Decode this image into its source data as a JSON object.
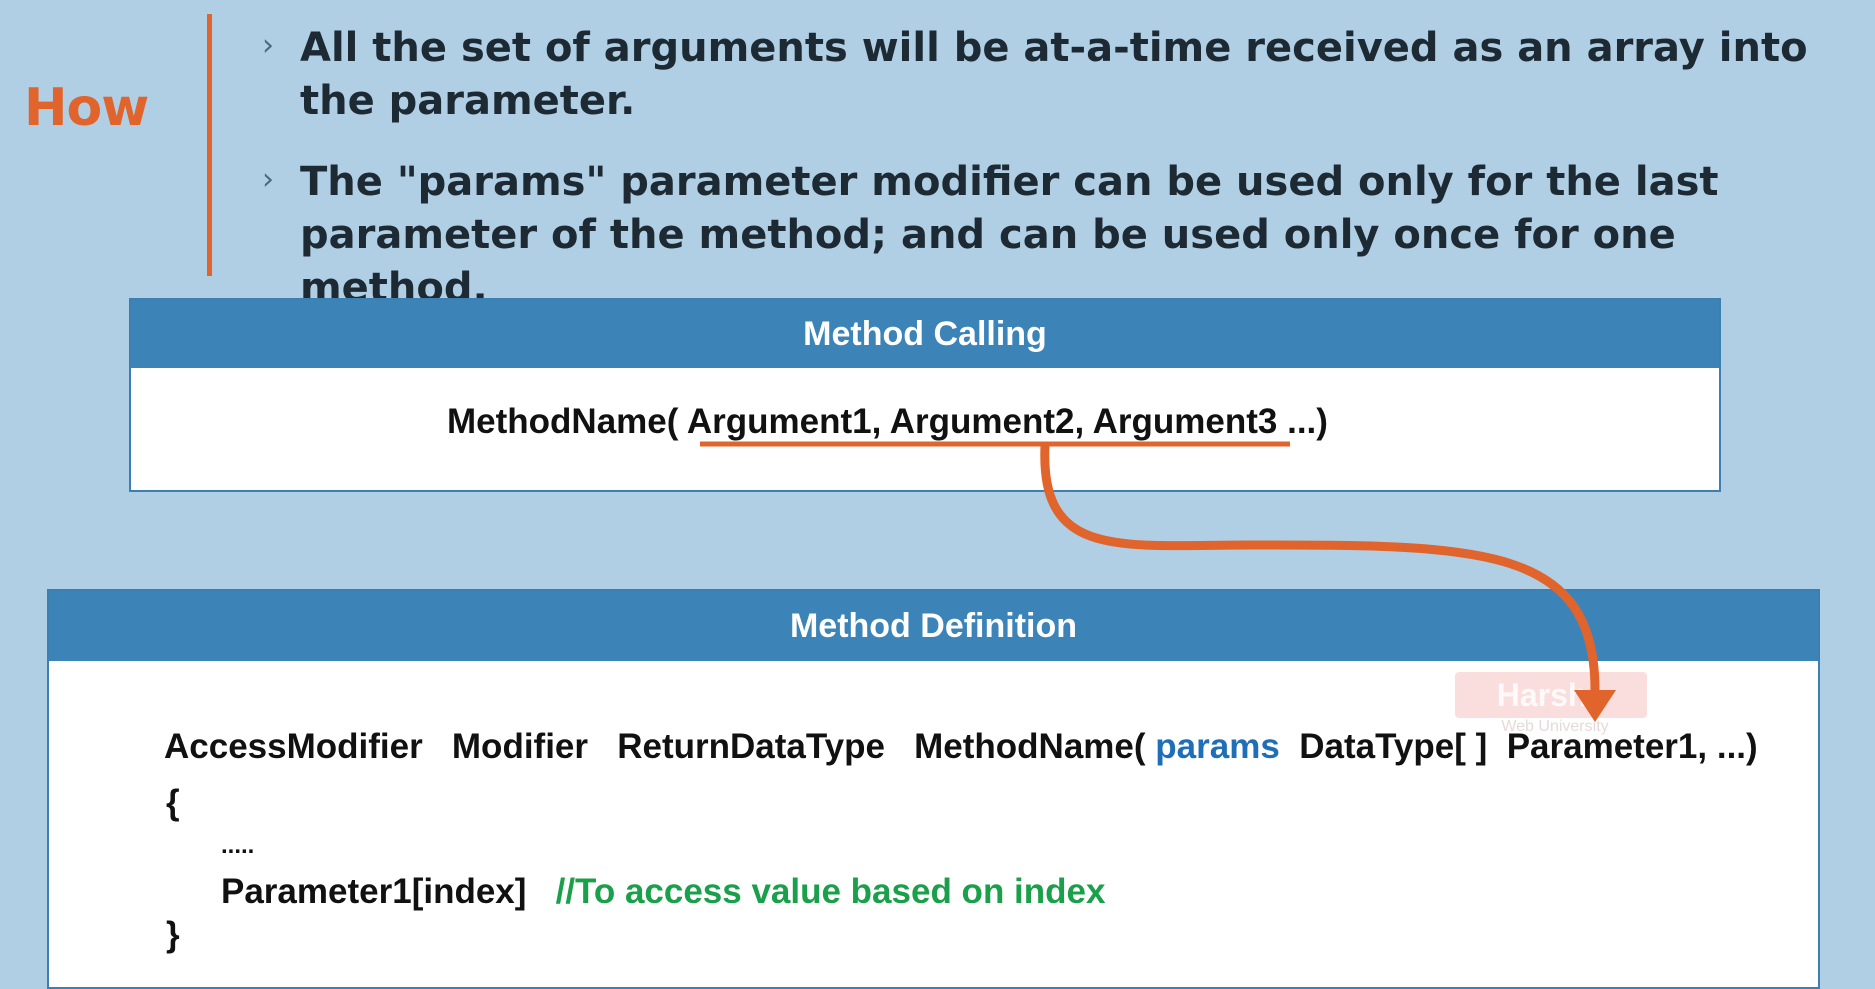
{
  "heading": "How",
  "bullets": [
    "All the set of arguments will be at-a-time received as an array into the parameter.",
    "The \"params\" parameter modifier can be used only for the last parameter of the method; and can be used only once for one method."
  ],
  "bullet_marker": "›",
  "method_calling": {
    "header": "Method Calling",
    "method_name": "MethodName(",
    "arguments": "Argument1, Argument2, Argument3",
    "tail": "...)"
  },
  "method_definition": {
    "header": "Method Definition",
    "access_modifier": "AccessModifier",
    "modifier": "Modifier",
    "return_type": "ReturnDataType",
    "method_name": "MethodName(",
    "params_keyword": "params",
    "datatype": "DataType[ ]",
    "parameter": "Parameter1, ...)",
    "open_brace": "{",
    "ellipsis_line": ".....",
    "access_line": "Parameter1[index]",
    "comment": "//To access value based on index",
    "close_brace": "}"
  },
  "watermark": {
    "text": "Harsha",
    "subtext": "Web University"
  },
  "colors": {
    "background": "#b0cfe5",
    "accent": "#e0642b",
    "header_blue": "#3c84b8",
    "keyword_blue": "#1f6eb8",
    "comment_green": "#1aa04a"
  }
}
